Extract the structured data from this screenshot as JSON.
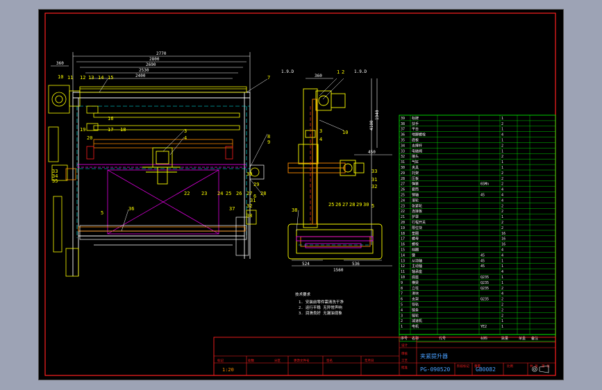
{
  "colors": {
    "frame": "#ff2020",
    "outline": "#ffff00",
    "dim": "#ffffff",
    "table": "#00ff00",
    "cyan": "#00ffff",
    "magenta": "#ff00ff",
    "orange": "#ff8c00",
    "title_blue": "#4aa0ff"
  },
  "front_view": {
    "dims": [
      "2770",
      "2800",
      "2690",
      "2530",
      "2400",
      "360"
    ],
    "balloons": [
      "10",
      "12",
      "13",
      "14",
      "15",
      "16",
      "17",
      "18",
      "19",
      "20",
      "11",
      "3",
      "4",
      "5",
      "6",
      "7",
      "8",
      "9",
      "22",
      "23",
      "24",
      "25",
      "26",
      "27",
      "28",
      "29",
      "30",
      "31",
      "32",
      "33",
      "34",
      "35",
      "36",
      "37",
      "38"
    ]
  },
  "side_view": {
    "view_labels": [
      "1.9.D",
      "1.9.D"
    ],
    "dims": [
      "360",
      "4100",
      "1940",
      "450",
      "524",
      "536",
      "1560"
    ],
    "balloons": [
      "1",
      "2",
      "3",
      "4",
      "10",
      "31",
      "32",
      "33",
      "25",
      "26",
      "27",
      "28",
      "29",
      "30",
      "38",
      "5"
    ]
  },
  "notes": {
    "lines": [
      "技术要求",
      "1. 安装前零件需清洗干净",
      "2. 运行平稳 无异常声响",
      "3. 润滑良好 无漏油现象"
    ]
  },
  "bom": {
    "rows": [
      [
        "1",
        "电机",
        "",
        "YE2",
        "1",
        "",
        ""
      ],
      [
        "2",
        "减速机",
        "",
        "",
        "1",
        "",
        ""
      ],
      [
        "3",
        "链轮",
        "",
        "",
        "2",
        "",
        ""
      ],
      [
        "4",
        "链条",
        "",
        "",
        "2",
        "",
        ""
      ],
      [
        "5",
        "导轨",
        "",
        "",
        "2",
        "",
        ""
      ],
      [
        "6",
        "支架",
        "",
        "Q235",
        "2",
        "",
        ""
      ],
      [
        "7",
        "滑块",
        "",
        "",
        "4",
        "",
        ""
      ],
      [
        "8",
        "立柱",
        "",
        "Q235",
        "2",
        "",
        ""
      ],
      [
        "9",
        "横梁",
        "",
        "Q235",
        "1",
        "",
        ""
      ],
      [
        "10",
        "底座",
        "",
        "Q235",
        "1",
        "",
        ""
      ],
      [
        "11",
        "轴承座",
        "",
        "",
        "4",
        "",
        ""
      ],
      [
        "12",
        "主动轴",
        "",
        "45",
        "1",
        "",
        ""
      ],
      [
        "13",
        "从动轴",
        "",
        "45",
        "1",
        "",
        ""
      ],
      [
        "14",
        "键",
        "",
        "45",
        "4",
        "",
        ""
      ],
      [
        "15",
        "挡圈",
        "",
        "",
        "4",
        "",
        ""
      ],
      [
        "16",
        "螺栓",
        "",
        "",
        "16",
        "",
        ""
      ],
      [
        "17",
        "螺母",
        "",
        "",
        "16",
        "",
        ""
      ],
      [
        "18",
        "垫圈",
        "",
        "",
        "16",
        "",
        ""
      ],
      [
        "19",
        "限位块",
        "",
        "",
        "2",
        "",
        ""
      ],
      [
        "20",
        "行程开关",
        "",
        "",
        "2",
        "",
        ""
      ],
      [
        "21",
        "护罩",
        "",
        "",
        "1",
        "",
        ""
      ],
      [
        "22",
        "连接板",
        "",
        "",
        "2",
        "",
        ""
      ],
      [
        "23",
        "张紧轮",
        "",
        "",
        "2",
        "",
        ""
      ],
      [
        "24",
        "滚轮",
        "",
        "",
        "4",
        "",
        ""
      ],
      [
        "25",
        "销轴",
        "",
        "45",
        "4",
        "",
        ""
      ],
      [
        "26",
        "套筒",
        "",
        "",
        "4",
        "",
        ""
      ],
      [
        "27",
        "弹簧",
        "",
        "65Mn",
        "2",
        "",
        ""
      ],
      [
        "28",
        "压板",
        "",
        "",
        "2",
        "",
        ""
      ],
      [
        "29",
        "托架",
        "",
        "",
        "2",
        "",
        ""
      ],
      [
        "30",
        "夹具",
        "",
        "",
        "1",
        "",
        ""
      ],
      [
        "31",
        "气缸",
        "",
        "",
        "1",
        "",
        ""
      ],
      [
        "32",
        "接头",
        "",
        "",
        "2",
        "",
        ""
      ],
      [
        "33",
        "电磁阀",
        "",
        "",
        "1",
        "",
        ""
      ],
      [
        "34",
        "支撑杆",
        "",
        "",
        "2",
        "",
        ""
      ],
      [
        "35",
        "底板",
        "",
        "",
        "1",
        "",
        ""
      ],
      [
        "36",
        "地脚螺栓",
        "",
        "",
        "4",
        "",
        ""
      ],
      [
        "37",
        "平台",
        "",
        "",
        "1",
        "",
        ""
      ],
      [
        "38",
        "扶手",
        "",
        "",
        "2",
        "",
        ""
      ],
      [
        "39",
        "标牌",
        "",
        "",
        "1",
        "",
        ""
      ]
    ],
    "header": [
      "序号",
      "名称",
      "代号",
      "材料",
      "数量",
      "单重",
      "备注"
    ]
  },
  "title_block": {
    "drawing_name": "夹紧提升器",
    "drawing_no": "PG-090520",
    "code": "GB0082",
    "scale": "1:20",
    "small_labels": [
      "标记",
      "处数",
      "分区",
      "更改文件号",
      "签名",
      "年月日",
      "设计",
      "审核",
      "工艺",
      "批准",
      "阶段标记",
      "重量",
      "比例",
      "共 张",
      "第 张"
    ]
  }
}
